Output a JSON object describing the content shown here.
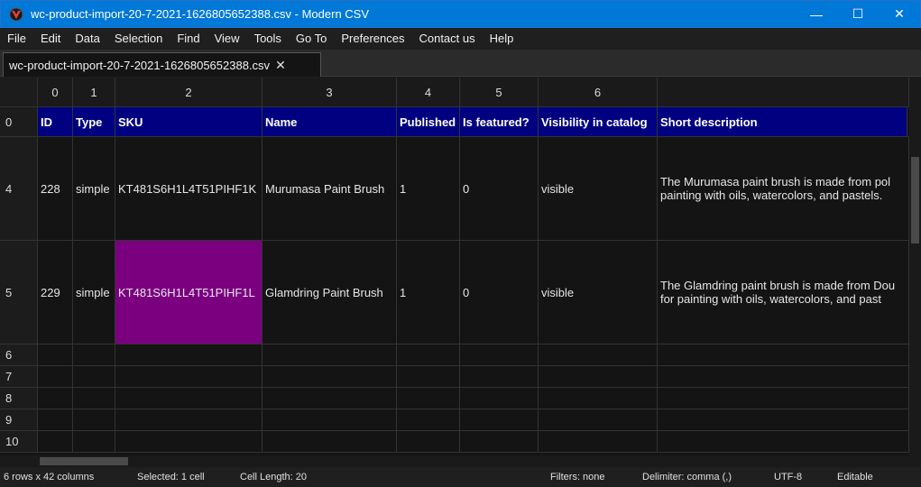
{
  "window": {
    "title": "wc-product-import-20-7-2021-1626805652388.csv - Modern CSV",
    "minimize": "—",
    "maximize": "☐",
    "close": "✕"
  },
  "menu": [
    "File",
    "Edit",
    "Data",
    "Selection",
    "Find",
    "View",
    "Tools",
    "Go To",
    "Preferences",
    "Contact us",
    "Help"
  ],
  "tab": {
    "label": "wc-product-import-20-7-2021-1626805652388.csv",
    "close": "✕"
  },
  "column_indices": [
    "0",
    "1",
    "2",
    "3",
    "4",
    "5",
    "6"
  ],
  "header_row": {
    "row_number": "0",
    "cells": [
      "ID",
      "Type",
      "SKU",
      "Name",
      "Published",
      "Is featured?",
      "Visibility in catalog",
      "Short description"
    ]
  },
  "data_rows": [
    {
      "row_number": "4",
      "cells": [
        "228",
        "simple",
        "KT481S6H1L4T51PIHF1K",
        "Murumasa Paint Brush",
        "1",
        "0",
        "visible"
      ],
      "desc_line1": "The Murumasa paint brush is made from pol",
      "desc_line2": "painting with oils, watercolors, and pastels."
    },
    {
      "row_number": "5",
      "cells": [
        "229",
        "simple",
        "KT481S6H1L4T51PIHF1L",
        "Glamdring Paint Brush",
        "1",
        "0",
        "visible"
      ],
      "desc_line1": "The Glamdring paint brush is made from Dou",
      "desc_line2": "for painting with oils, watercolors, and past"
    }
  ],
  "empty_rows": [
    "6",
    "7",
    "8",
    "9",
    "10"
  ],
  "status": {
    "dimensions": "6 rows x 42 columns",
    "selected": "Selected: 1 cell",
    "cell_length": "Cell Length: 20",
    "filters": "Filters: none",
    "delimiter": "Delimiter: comma (,)",
    "encoding": "UTF-8",
    "mode": "Editable"
  },
  "colors": {
    "titlebar": "#0078d7",
    "header_row_bg": "#000080",
    "selected_cell_bg": "#7a0080"
  }
}
